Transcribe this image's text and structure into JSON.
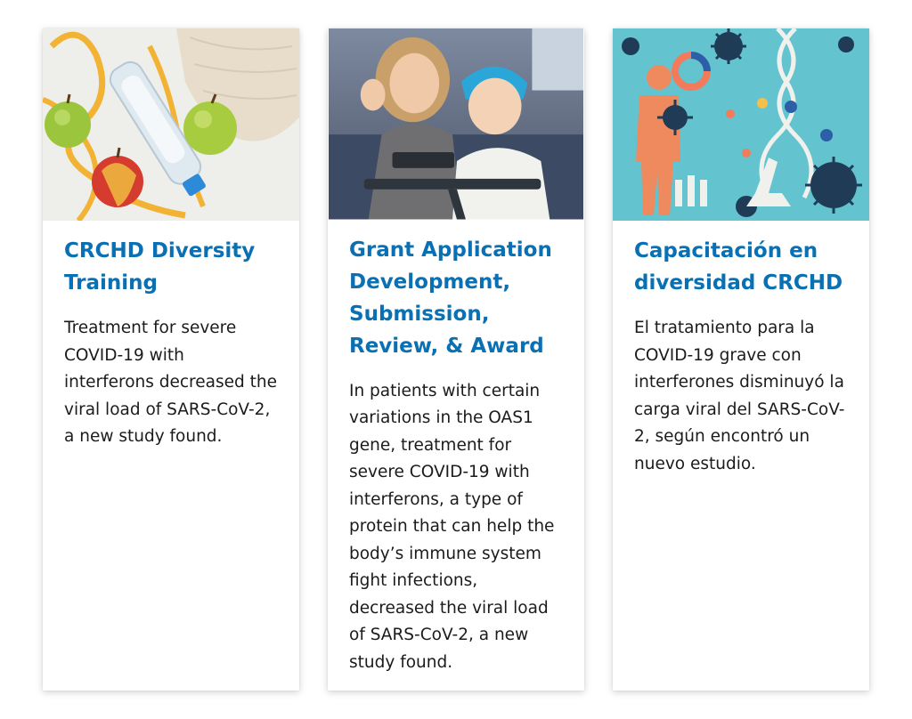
{
  "colors": {
    "title": "#0a70b4",
    "text": "#1b1b1b",
    "card_bg": "#ffffff"
  },
  "cards": [
    {
      "image_icon": "healthy-lifestyle-photo",
      "title": "CRCHD Diversity Training",
      "text": "Treatment for severe COVID-19 with interferons decreased the viral load of SARS-CoV-2, a new study found."
    },
    {
      "image_icon": "patient-video-call-photo",
      "title": "Grant Application Development, Submission, Review, & Award",
      "text": "In patients with certain variations in the OAS1 gene, treatment for severe COVID-19 with interferons, a type of protein that can help the body’s immune system fight infections, decreased the viral load of SARS-CoV-2, a new study found."
    },
    {
      "image_icon": "virus-dna-illustration",
      "title": "Capacitación en diversidad CRCHD",
      "text": "El tratamiento para la COVID-19 grave con interferones disminuyó la carga viral del SARS-CoV-2, según encontró un nuevo estudio."
    }
  ]
}
